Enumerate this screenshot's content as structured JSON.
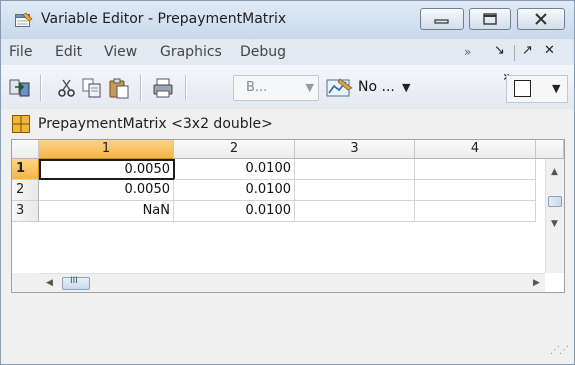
{
  "window": {
    "title": "Variable Editor - PrepaymentMatrix",
    "icons": {
      "app": "variable-editor-icon",
      "min": "minimize-icon",
      "max": "maximize-icon",
      "close": "close-icon"
    }
  },
  "menubar": {
    "items": [
      "File",
      "Edit",
      "View",
      "Graphics",
      "Debug"
    ],
    "right": {
      "overflow": "»",
      "dock": "↘",
      "undock": "↗",
      "close": "✕"
    }
  },
  "toolbar": {
    "icons": [
      "import-icon",
      "cut-icon",
      "copy-icon",
      "paste-icon",
      "print-icon",
      "plot-selection-icon",
      "checkbox-icon"
    ],
    "combo_base": "B...",
    "combo_plot": "No ...",
    "overflow": "»"
  },
  "variable": {
    "icon": "matrix-grid-icon",
    "title": "PrepaymentMatrix <3x2 double>"
  },
  "grid": {
    "columns": [
      "1",
      "2",
      "3",
      "4"
    ],
    "rows": [
      {
        "label": "1",
        "cells": [
          "0.0050",
          "0.0100",
          "",
          ""
        ]
      },
      {
        "label": "2",
        "cells": [
          "0.0050",
          "0.0100",
          "",
          ""
        ]
      },
      {
        "label": "3",
        "cells": [
          "NaN",
          "0.0100",
          "",
          ""
        ]
      }
    ],
    "hscroll_thumb": "III"
  }
}
